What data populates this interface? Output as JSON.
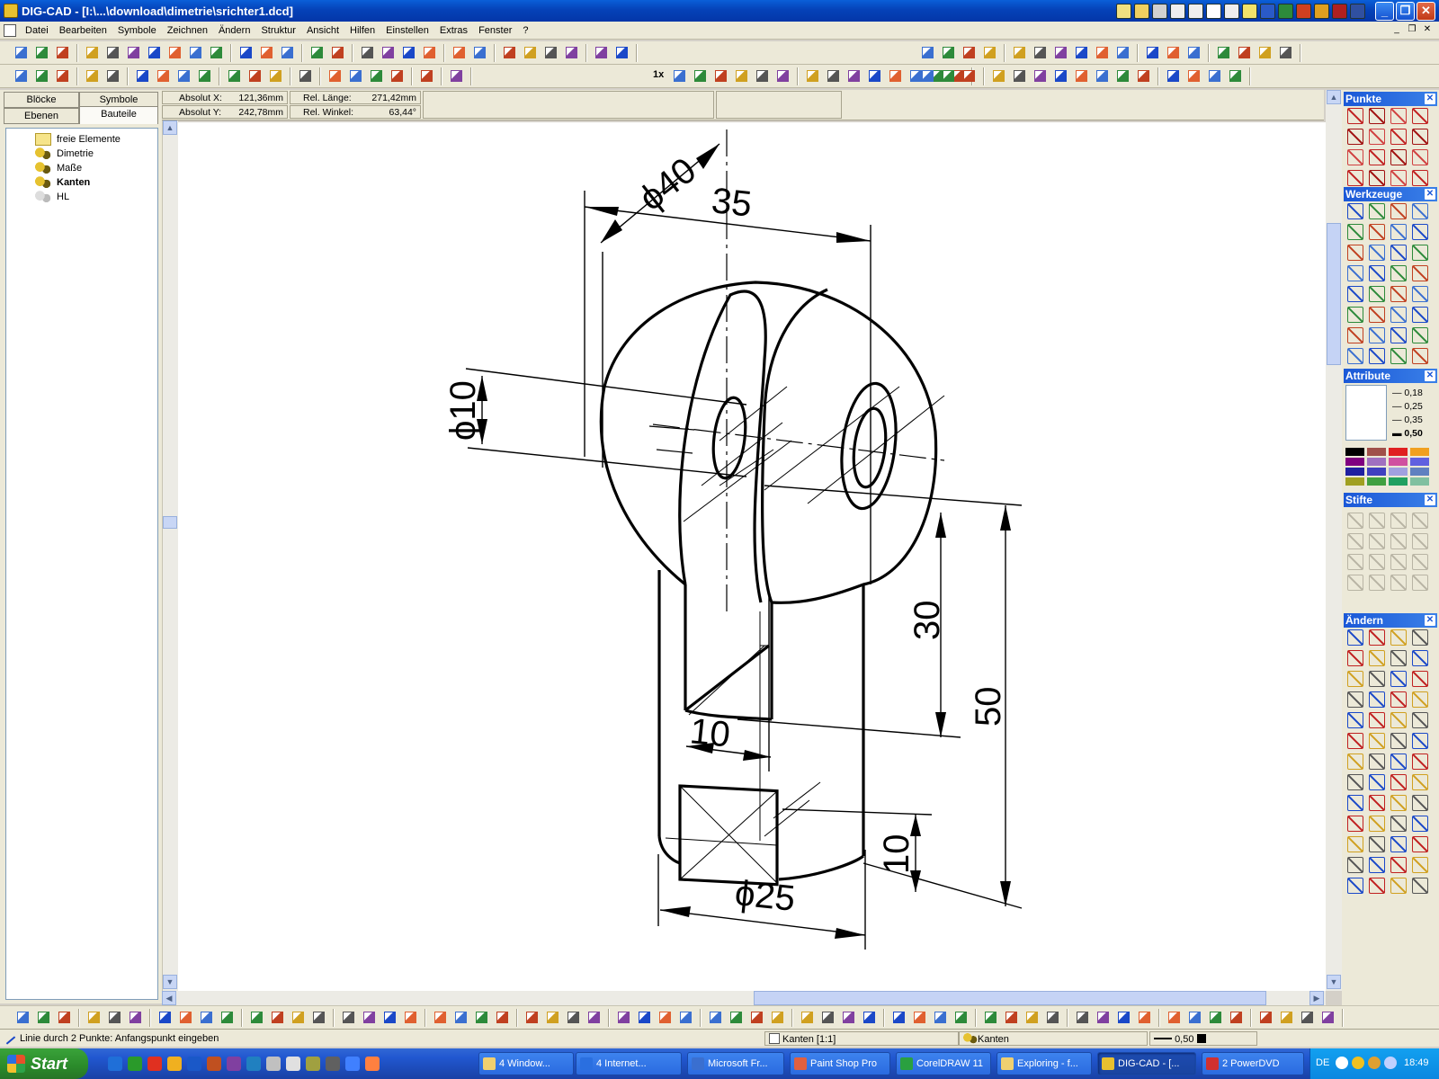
{
  "window": {
    "title": "DIG-CAD - [I:\\...\\download\\dimetrie\\srichter1.dcd]",
    "mdi_controls": [
      "_",
      "❐",
      "✕"
    ]
  },
  "menu": [
    "Datei",
    "Bearbeiten",
    "Symbole",
    "Zeichnen",
    "Ändern",
    "Struktur",
    "Ansicht",
    "Hilfen",
    "Einstellen",
    "Extras",
    "Fenster",
    "?"
  ],
  "left_panel": {
    "tabs": [
      "Blöcke",
      "Symbole",
      "Ebenen",
      "Bauteile"
    ],
    "tree": [
      {
        "label": "freie Elemente",
        "icon": "folder-icon"
      },
      {
        "label": "Dimetrie",
        "icon": "parts-icon"
      },
      {
        "label": "Maße",
        "icon": "parts-icon"
      },
      {
        "label": "Kanten",
        "icon": "parts-icon",
        "bold": true
      },
      {
        "label": "HL",
        "icon": "parts-disabled-icon"
      }
    ]
  },
  "coords": {
    "abs_x_label": "Absolut X:",
    "abs_x": "121,36mm",
    "abs_y_label": "Absolut Y:",
    "abs_y": "242,78mm",
    "rel_len_label": "Rel. Länge:",
    "rel_len": "271,42mm",
    "rel_angle_label": "Rel. Winkel:",
    "rel_angle": "63,44°"
  },
  "drawing": {
    "dim_d40": "ϕ40",
    "dim_35": "35",
    "dim_d10": "ϕ10",
    "dim_30": "30",
    "dim_50": "50",
    "dim_10a": "10",
    "dim_10b": "10",
    "dim_d25": "ϕ25"
  },
  "palettes": {
    "punkte": "Punkte",
    "werkzeuge": "Werkzeuge",
    "attribute": "Attribute",
    "line_widths": [
      "0,18",
      "0,25",
      "0,35",
      "0,50"
    ],
    "stifte": "Stifte",
    "aendern": "Ändern",
    "toolbar_text_1x": "1x"
  },
  "status": {
    "hint": "Linie durch 2 Punkte: Anfangspunkt eingeben",
    "view": "Kanten [1:1]",
    "layer": "Kanten",
    "line_width": "0,50"
  },
  "taskbar": {
    "start": "Start",
    "tasks": [
      "4 Window...",
      "4 Internet...",
      "Microsoft Fr...",
      "Paint Shop Pro",
      "CorelDRAW 11",
      "Exploring - f...",
      "DIG-CAD - [...",
      "2 PowerDVD"
    ],
    "lang": "DE",
    "clock": "18:49"
  },
  "colors": {
    "xp_blue": "#0542b8",
    "panel": "#ece9d8",
    "palette_header": "#1b58d7",
    "attr_colors": [
      "#000000",
      "#a0504a",
      "#e02020",
      "#f0a020",
      "#800080",
      "#a070c0",
      "#d050a0",
      "#6060e0",
      "#2020a0",
      "#4040c0",
      "#a0a0e0",
      "#6080c0",
      "#a0a020",
      "#40a040",
      "#20a060",
      "#80c0a0"
    ]
  }
}
